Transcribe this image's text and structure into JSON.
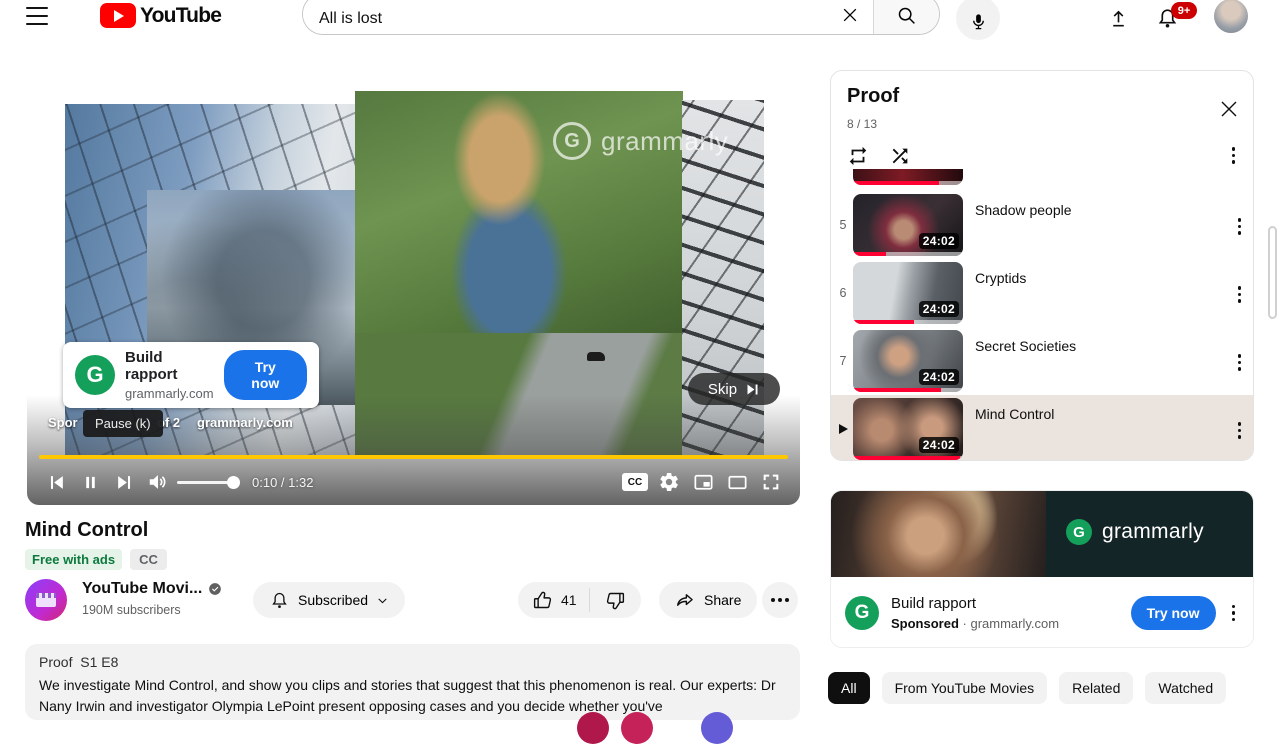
{
  "colors": {
    "accent_blue": "#1a73e8",
    "grammarly_green": "#149f5a",
    "progress_red": "#ff0033",
    "ad_yellow": "#ffc800",
    "badge_red": "#cc0000",
    "youtube_red": "#ff0000"
  },
  "header": {
    "brand": "YouTube",
    "search_value": "All is lost",
    "notification_count": "9+"
  },
  "player": {
    "watermark": "grammarly",
    "overlay": {
      "title": "Build rapport",
      "domain": "grammarly.com",
      "cta": "Try now"
    },
    "skip_label": "Skip",
    "tooltip": "Pause (k)",
    "sponsored_fragment": "Spor",
    "ad_sequence": "of 2",
    "ad_domain": "grammarly.com",
    "time": "0:10 / 1:32",
    "cc_icon_label": "CC"
  },
  "video": {
    "title": "Mind Control",
    "free_badge": "Free with ads",
    "cc_badge": "CC",
    "channel_name": "YouTube Movi...",
    "subscribers": "190M subscribers",
    "subscribed_label": "Subscribed",
    "like_count": "41",
    "share_label": "Share"
  },
  "description": {
    "show_meta": "Proof  S1 E8",
    "body": "We investigate Mind Control, and show you clips and stories that suggest that this phenomenon is real. Our experts: Dr Nany Irwin and investigator Olympia LePoint present opposing cases and you decide whether you've"
  },
  "playlist": {
    "title": "Proof",
    "position": "8 / 13",
    "partial_item_progress": 78,
    "items": [
      {
        "index": "5",
        "title": "Shadow people",
        "duration": "24:02",
        "progress": 30
      },
      {
        "index": "6",
        "title": "Cryptids",
        "duration": "24:02",
        "progress": 55
      },
      {
        "index": "7",
        "title": "Secret Societies",
        "duration": "24:02",
        "progress": 80
      },
      {
        "index": "8",
        "title": "Mind Control",
        "duration": "24:02",
        "progress": 97
      }
    ]
  },
  "ad_card": {
    "brand": "grammarly",
    "brand_letter": "G",
    "title": "Build rapport",
    "sponsored_label": "Sponsored",
    "domain": "grammarly.com",
    "cta": "Try now"
  },
  "chips": [
    {
      "label": "All"
    },
    {
      "label": "From YouTube Movies"
    },
    {
      "label": "Related"
    },
    {
      "label": "Watched"
    }
  ]
}
